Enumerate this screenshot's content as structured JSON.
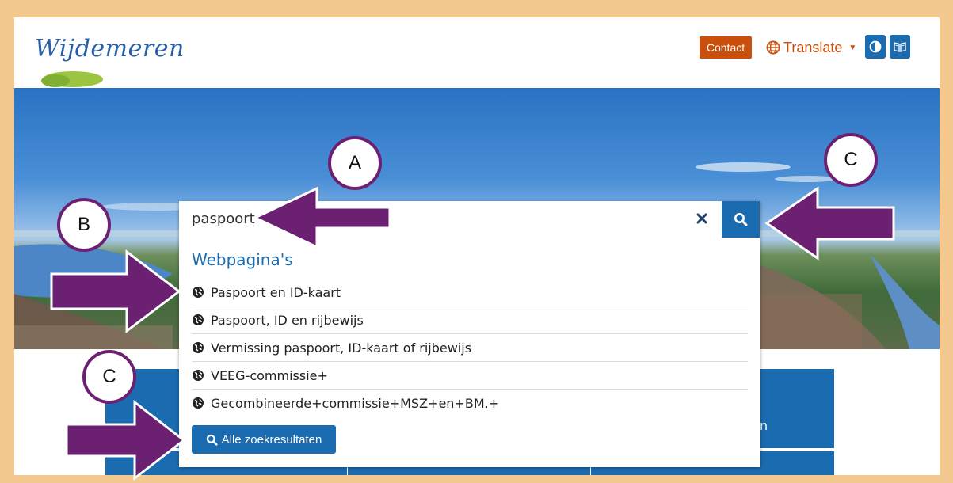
{
  "header": {
    "logo_text": "Wijdemeren",
    "contact_label": "Contact",
    "translate_label": "Translate",
    "contrast_icon": "contrast-icon",
    "reader_icon": "book-icon"
  },
  "search": {
    "query": "paspoort",
    "clear_icon": "close-icon",
    "submit_icon": "search-icon",
    "results_heading": "Webpagina's",
    "results": [
      "Paspoort en ID-kaart",
      "Paspoort, ID en rijbewijs",
      "Vermissing paspoort, ID-kaart of rijbewijs",
      "VEEG-commissie+",
      "Gecombineerde+commissie+MSZ+en+BM.+"
    ],
    "all_results_label": "Alle zoekresultaten"
  },
  "tiles": {
    "partial_label": "n"
  },
  "annotations": {
    "a_label": "A",
    "b_label": "B",
    "c_top_label": "C",
    "c_bottom_label": "C",
    "arrow_color": "#6b2072"
  },
  "colors": {
    "frame": "#f3c98f",
    "primary": "#1b6bb0",
    "accent": "#c94f0c"
  }
}
